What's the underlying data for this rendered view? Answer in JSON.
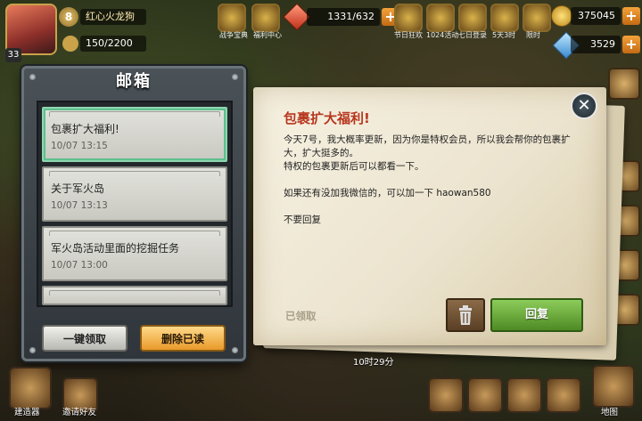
{
  "hud": {
    "player_name": "红心火龙狗",
    "rank": "8",
    "level": "33",
    "exp": "150/2200",
    "resource_1": "1331/632",
    "gold": "375045",
    "gems": "3529",
    "top_icons": [
      {
        "icon": "helmet-icon",
        "caption": "战争宝典"
      },
      {
        "icon": "coin-medal-icon",
        "caption": "福利中心"
      },
      {
        "icon": "balloons-icon",
        "caption": "节日狂欢"
      },
      {
        "icon": "hero-portrait-icon",
        "caption": "1024活动"
      },
      {
        "icon": "calendar-icon",
        "caption": "七日登录"
      },
      {
        "icon": "target-icon",
        "caption": "5天3时"
      },
      {
        "icon": "chest-icon",
        "caption": "限时"
      }
    ]
  },
  "mailbox": {
    "title": "邮箱",
    "items": [
      {
        "subject": "包裹扩大福利!",
        "date": "10/07 13:15",
        "selected": true
      },
      {
        "subject": "关于军火岛",
        "date": "10/07 13:13",
        "selected": false
      },
      {
        "subject": "军火岛活动里面的挖掘任务",
        "date": "10/07 13:00",
        "selected": false
      }
    ],
    "claim_all_label": "一键领取",
    "delete_read_label": "删除已读"
  },
  "letter": {
    "title": "包裹扩大福利!",
    "paragraphs": [
      "今天7号，我大概率更新，因为你是特权会员，所以我会帮你的包裹扩大，扩大挺多的。\n特权的包裹更新后可以都看一下。",
      "如果还有没加我微信的，可以加一下 haowan580",
      "不要回复"
    ],
    "claimed_label": "已领取",
    "reply_label": "回复"
  },
  "bottom": {
    "builder_label": "建造器",
    "invite_label": "邀请好友",
    "timer": "10时29分",
    "map_label": "地图"
  },
  "colors": {
    "letter_title": "#b7361e",
    "reply_green": "#5e9e30",
    "delete_orange": "#e89a2a",
    "selected_outline": "#5ec08e"
  }
}
